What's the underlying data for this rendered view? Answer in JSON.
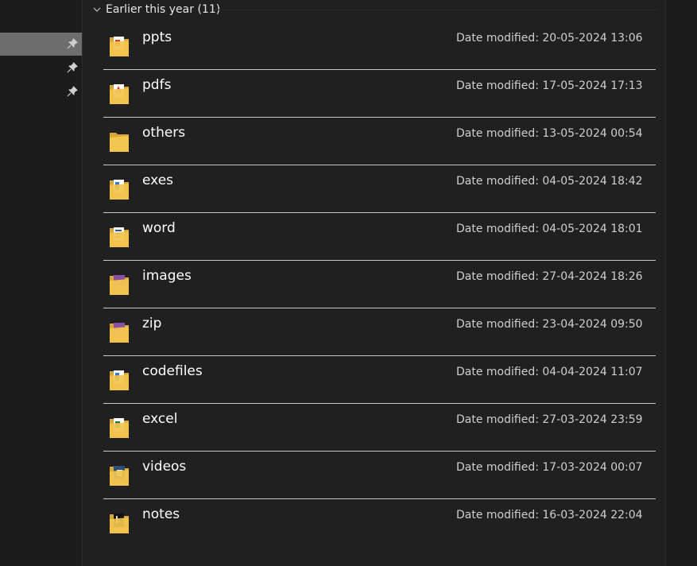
{
  "group": {
    "title": "Earlier this year (11)"
  },
  "colors": {
    "folder": "#f3c64f",
    "folder_dark": "#d8a93a",
    "divider": "#c9c9c9",
    "nav_selected": "#6d6d6d"
  },
  "items": [
    {
      "name": "ppts",
      "date_label": "Date modified:",
      "date": "20-05-2024 13:06",
      "icon": "folder-with-ppt-icon"
    },
    {
      "name": "pdfs",
      "date_label": "Date modified:",
      "date": "17-05-2024 17:13",
      "icon": "folder-with-pdf-icon"
    },
    {
      "name": "others",
      "date_label": "Date modified:",
      "date": "13-05-2024 00:54",
      "icon": "folder-icon"
    },
    {
      "name": "exes",
      "date_label": "Date modified:",
      "date": "04-05-2024 18:42",
      "icon": "folder-with-files-icon"
    },
    {
      "name": "word",
      "date_label": "Date modified:",
      "date": "04-05-2024 18:01",
      "icon": "folder-with-docs-icon"
    },
    {
      "name": "images",
      "date_label": "Date modified:",
      "date": "27-04-2024 18:26",
      "icon": "folder-with-image-icon"
    },
    {
      "name": "zip",
      "date_label": "Date modified:",
      "date": "23-04-2024 09:50",
      "icon": "folder-with-image-icon"
    },
    {
      "name": "codefiles",
      "date_label": "Date modified:",
      "date": "04-04-2024 11:07",
      "icon": "folder-with-files-icon"
    },
    {
      "name": "excel",
      "date_label": "Date modified:",
      "date": "27-03-2024 23:59",
      "icon": "folder-with-sheets-icon"
    },
    {
      "name": "videos",
      "date_label": "Date modified:",
      "date": "17-03-2024 00:07",
      "icon": "folder-with-video-icon"
    },
    {
      "name": "notes",
      "date_label": "Date modified:",
      "date": "16-03-2024 22:04",
      "icon": "folder-with-notes-icon"
    }
  ]
}
